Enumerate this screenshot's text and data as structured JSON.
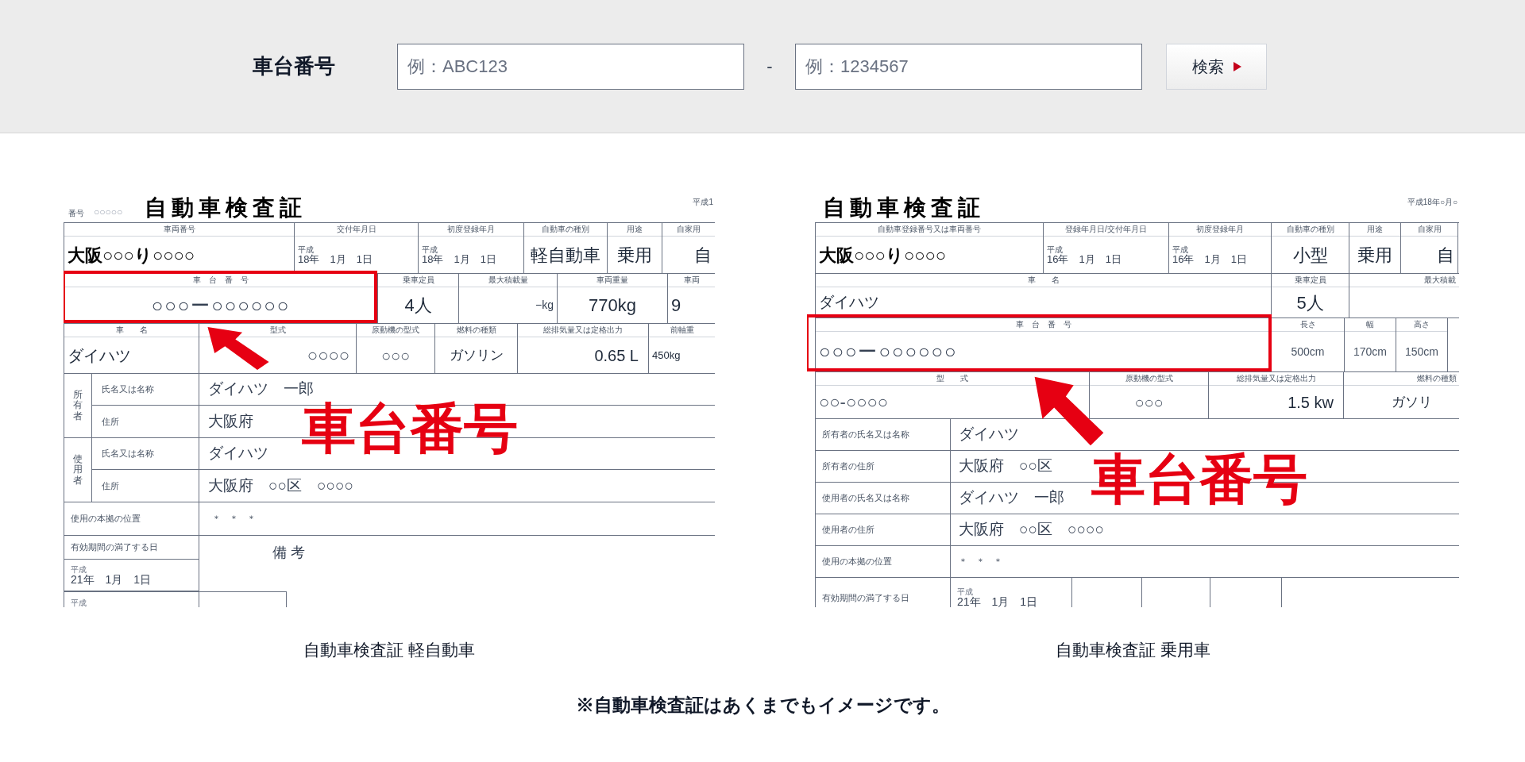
{
  "search": {
    "label": "車台番号",
    "prefix_field": {
      "placeholder": "例：ABC123"
    },
    "separator": "-",
    "number_field": {
      "placeholder": "例：1234567"
    },
    "button": "検索"
  },
  "left_certificate": {
    "number_label": "番号",
    "number": "○○○○○",
    "title": "自動車検査証",
    "date": "平成1",
    "row1": [
      {
        "label": "車両番号",
        "value": "**大阪**○○○**り**○○○○"
      },
      {
        "label": "交付年月日",
        "era": "平成",
        "value": "18年　1月　1日"
      },
      {
        "label": "初度登録年月",
        "era": "平成",
        "value": "18年　1月　1日"
      },
      {
        "label": "自動車の種別",
        "value": "軽自動車"
      },
      {
        "label": "用途",
        "value": "乗用"
      },
      {
        "label": "自家用",
        "value": "自"
      }
    ],
    "row2": [
      {
        "label": "車　台　番　号",
        "value": "○○○ー○○○○○○"
      },
      {
        "label": "乗車定員",
        "value": "4人"
      },
      {
        "label": "最大積載量",
        "value": "−kg"
      },
      {
        "label": "車両重量",
        "value": "770kg"
      },
      {
        "label": "車両",
        "value": "9"
      }
    ],
    "row3": [
      {
        "label": "車　　名",
        "value": "ダイハツ"
      },
      {
        "label": "型式",
        "value": "○○○○"
      },
      {
        "label": "原動機の型式",
        "value": "○○○"
      },
      {
        "label": "燃料の種類",
        "value": "ガソリン"
      },
      {
        "label": "総排気量又は定格出力",
        "value": "0.65 L"
      },
      {
        "label": "前軸重",
        "value": "450kg"
      }
    ],
    "persons": [
      {
        "group": "所有者",
        "fields": [
          {
            "label": "氏名又は名称",
            "value": "ダイハツ　一郎"
          },
          {
            "label": "住所",
            "value": "大阪府"
          }
        ]
      },
      {
        "group": "使用者",
        "fields": [
          {
            "label": "氏名又は名称",
            "value": "ダイハツ"
          },
          {
            "label": "住所",
            "value": "大阪府　○○区　○○○○"
          }
        ]
      }
    ],
    "location": {
      "label": "使用の本拠の位置",
      "value": "＊　＊　＊"
    },
    "expiry": {
      "label": "有効期間の満了する日",
      "era": "平成",
      "value": "21年　1月　1日",
      "era2": "平成",
      "remarks": "備 考"
    },
    "callout": "車台番号",
    "caption": "自動車検査証 軽自動車"
  },
  "right_certificate": {
    "title": "自動車検査証",
    "date": "平成18年○月○",
    "row1": [
      {
        "label": "自動車登録番号又は車両番号",
        "value": "**大阪**○○○**り**○○○○"
      },
      {
        "label": "登録年月日/交付年月日",
        "era": "平成",
        "value": "16年　1月　1日"
      },
      {
        "label": "初度登録年月",
        "era": "平成",
        "value": "16年　1月　1日"
      },
      {
        "label": "自動車の種別",
        "value": "小型"
      },
      {
        "label": "用途",
        "value": "乗用"
      },
      {
        "label": "自家用",
        "value": "自"
      }
    ],
    "row2": [
      {
        "label": "車　　名",
        "value": "ダイハツ"
      },
      {
        "label": "乗車定員",
        "value": "5人"
      },
      {
        "label": "最大積載"
      }
    ],
    "row3": [
      {
        "label": "車　台　番　号",
        "value": "○○○ー○○○○○○"
      },
      {
        "label": "長さ",
        "value": "500cm"
      },
      {
        "label": "幅",
        "value": "170cm"
      },
      {
        "label": "高さ",
        "value": "150cm"
      }
    ],
    "row4": [
      {
        "label": "型　　式",
        "value": "○○-○○○○"
      },
      {
        "label": "原動機の型式",
        "value": "○○○"
      },
      {
        "label": "総排気量又は定格出力",
        "value": "1.5 kw"
      },
      {
        "label": "燃料の種類",
        "value": "ガソリ"
      }
    ],
    "fields": [
      {
        "label": "所有者の氏名又は名称",
        "value": "ダイハツ"
      },
      {
        "label": "所有者の住所",
        "value": "大阪府　○○区"
      },
      {
        "label": "使用者の氏名又は名称",
        "value": "ダイハツ　一郎"
      },
      {
        "label": "使用者の住所",
        "value": "大阪府　○○区　○○○○"
      },
      {
        "label": "使用の本拠の位置",
        "value": "＊　＊　＊"
      }
    ],
    "expiry": {
      "label": "有効期間の満了する日",
      "era": "平成",
      "value": "21年　1月　1日"
    },
    "callout": "車台番号",
    "caption": "自動車検査証 乗用車"
  },
  "note": "※自動車検査証はあくまでもイメージです。"
}
